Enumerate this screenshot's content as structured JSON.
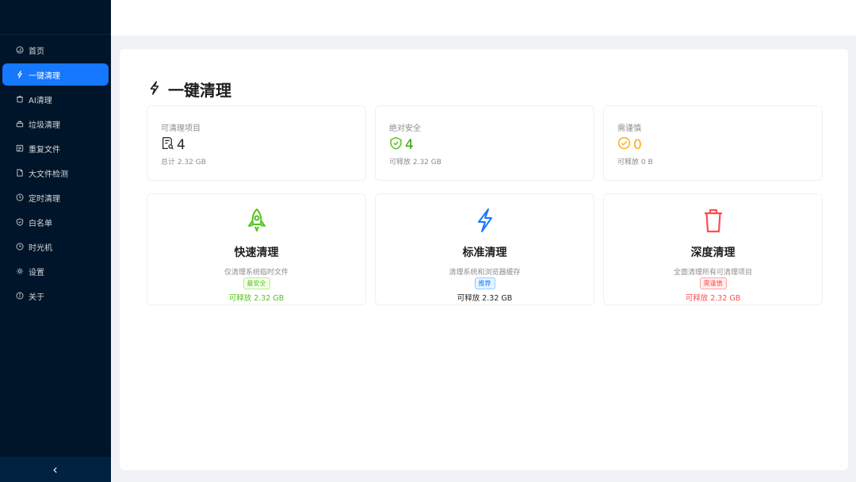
{
  "sidebar": {
    "items": [
      {
        "label": "首页",
        "icon": "dashboard-icon",
        "active": false
      },
      {
        "label": "一键清理",
        "icon": "lightning-icon",
        "active": true
      },
      {
        "label": "AI清理",
        "icon": "ai-icon",
        "active": false
      },
      {
        "label": "垃圾清理",
        "icon": "trash-bin-icon",
        "active": false
      },
      {
        "label": "重复文件",
        "icon": "duplicate-file-icon",
        "active": false
      },
      {
        "label": "大文件检测",
        "icon": "file-icon",
        "active": false
      },
      {
        "label": "定时清理",
        "icon": "clock-icon",
        "active": false
      },
      {
        "label": "白名单",
        "icon": "shield-check-icon",
        "active": false
      },
      {
        "label": "时光机",
        "icon": "history-icon",
        "active": false
      },
      {
        "label": "设置",
        "icon": "gear-icon",
        "active": false
      },
      {
        "label": "关于",
        "icon": "info-icon",
        "active": false
      }
    ],
    "collapse_label": "<"
  },
  "page": {
    "title": "一键清理"
  },
  "stats": [
    {
      "label": "可清理项目",
      "value": "4",
      "sub": "总计 2.32 GB",
      "color": "#262626",
      "icon": "file-search-icon"
    },
    {
      "label": "绝对安全",
      "value": "4",
      "sub": "可释放 2.32 GB",
      "color": "#52c41a",
      "icon": "safety-icon"
    },
    {
      "label": "需谨慎",
      "value": "0",
      "sub": "可释放 0 B",
      "color": "#faad14",
      "icon": "check-circle-icon"
    }
  ],
  "actions": [
    {
      "title": "快速清理",
      "desc": "仅清理系统临时文件",
      "tag": "最安全",
      "free": "可释放 2.32 GB",
      "color": "#52c41a",
      "free_color": "#52c41a",
      "icon": "rocket-icon"
    },
    {
      "title": "标准清理",
      "desc": "清理系统和浏览器缓存",
      "tag": "推荐",
      "free": "可释放 2.32 GB",
      "color": "#1677ff",
      "free_color": "#262626",
      "icon": "thunderbolt-icon"
    },
    {
      "title": "深度清理",
      "desc": "全面清理所有可清理项目",
      "tag": "需谨慎",
      "free": "可释放 2.32 GB",
      "color": "#ff4d4f",
      "free_color": "#ff4d4f",
      "icon": "delete-icon"
    }
  ]
}
